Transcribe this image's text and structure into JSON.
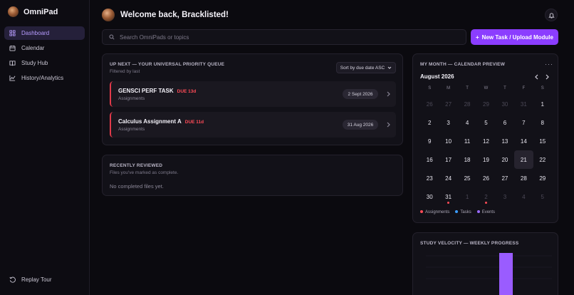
{
  "sidebar": {
    "brand": "OmniPad",
    "items": [
      {
        "label": "Dashboard",
        "icon": "dashboard-icon",
        "active": true
      },
      {
        "label": "Calendar",
        "icon": "calendar-icon"
      },
      {
        "label": "Study Hub",
        "icon": "book-icon"
      },
      {
        "label": "History/Analytics",
        "icon": "chart-line-icon"
      }
    ],
    "replay_label": "Replay Tour"
  },
  "header": {
    "welcome": "Welcome back, Bracklisted!"
  },
  "search": {
    "placeholder": "Search OmniPads or topics"
  },
  "new_task_label": "New Task / Upload Module",
  "queue": {
    "title": "UP NEXT — YOUR UNIVERSAL PRIORITY QUEUE",
    "subtitle": "Filtered by last",
    "sort_label": "Sort by due date ASC",
    "tasks": [
      {
        "name": "GENSCI PERF TASK",
        "due": "DUE 13d",
        "category": "Assignments",
        "date": "2 Sept 2026"
      },
      {
        "name": "Calculus Assignment A",
        "due": "DUE 11d",
        "category": "Assignments",
        "date": "31 Aug 2026"
      }
    ]
  },
  "reviewed": {
    "title": "RECENTLY REVIEWED",
    "subtitle": "Files you've marked as complete.",
    "empty": "No completed files yet."
  },
  "calendar": {
    "title": "MY MONTH — CALENDAR PREVIEW",
    "month": "August 2026",
    "weekdays": [
      "S",
      "M",
      "T",
      "W",
      "T",
      "F",
      "S"
    ],
    "days": [
      {
        "d": "26",
        "other": true
      },
      {
        "d": "27",
        "other": true
      },
      {
        "d": "28",
        "other": true
      },
      {
        "d": "29",
        "other": true
      },
      {
        "d": "30",
        "other": true
      },
      {
        "d": "31",
        "other": true
      },
      {
        "d": "1"
      },
      {
        "d": "2"
      },
      {
        "d": "3"
      },
      {
        "d": "4"
      },
      {
        "d": "5"
      },
      {
        "d": "6"
      },
      {
        "d": "7"
      },
      {
        "d": "8"
      },
      {
        "d": "9"
      },
      {
        "d": "10"
      },
      {
        "d": "11"
      },
      {
        "d": "12"
      },
      {
        "d": "13"
      },
      {
        "d": "14"
      },
      {
        "d": "15"
      },
      {
        "d": "16"
      },
      {
        "d": "17"
      },
      {
        "d": "18"
      },
      {
        "d": "19"
      },
      {
        "d": "20"
      },
      {
        "d": "21",
        "today": true
      },
      {
        "d": "22"
      },
      {
        "d": "23"
      },
      {
        "d": "24"
      },
      {
        "d": "25"
      },
      {
        "d": "26"
      },
      {
        "d": "27"
      },
      {
        "d": "28"
      },
      {
        "d": "29"
      },
      {
        "d": "30"
      },
      {
        "d": "31",
        "dot": true
      },
      {
        "d": "1",
        "other": true
      },
      {
        "d": "2",
        "other": true,
        "dot": true
      },
      {
        "d": "3",
        "other": true
      },
      {
        "d": "4",
        "other": true
      },
      {
        "d": "5",
        "other": true
      }
    ],
    "legend": [
      {
        "label": "Assignments",
        "color": "#ff4b57"
      },
      {
        "label": "Tasks",
        "color": "#3b9dff"
      },
      {
        "label": "Events",
        "color": "#9a6bff"
      }
    ]
  },
  "velocity": {
    "title": "STUDY VELOCITY — WEEKLY PROGRESS"
  },
  "colors": {
    "accent": "#8b3dff",
    "danger": "#ff4b57"
  }
}
